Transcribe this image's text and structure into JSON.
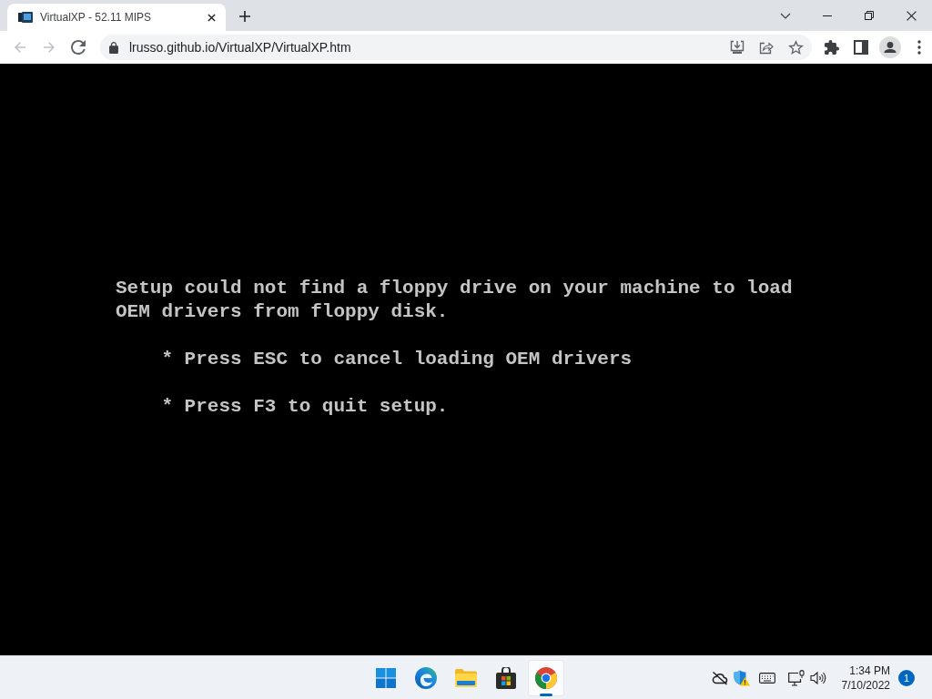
{
  "browser": {
    "tabs": [
      {
        "title": "VirtualXP - 52.11 MIPS",
        "selected": true
      }
    ],
    "back": {
      "disabled": true
    },
    "forward": {
      "disabled": true
    },
    "address": "lrusso.github.io/VirtualXP/VirtualXP.htm"
  },
  "screen": {
    "message": "Setup could not find a floppy drive on your machine to load OEM drivers from floppy disk.",
    "options": [
      "* Press ESC to cancel loading OEM drivers",
      "* Press F3 to quit setup."
    ]
  },
  "taskbar": {
    "apps": [
      {
        "kind": "start",
        "selected": false
      },
      {
        "kind": "edge",
        "selected": false
      },
      {
        "kind": "files",
        "selected": false
      },
      {
        "kind": "store",
        "selected": false
      },
      {
        "kind": "chrome",
        "selected": true
      }
    ],
    "time": "1:34 PM",
    "date": "7/10/2022",
    "notifications": "1"
  }
}
